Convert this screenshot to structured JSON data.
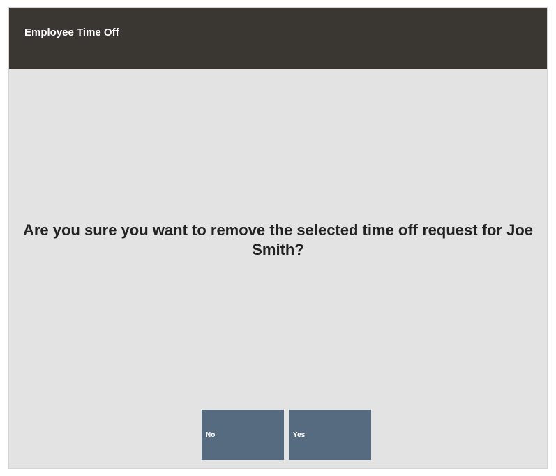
{
  "window": {
    "title": "Employee Time Off"
  },
  "dialog": {
    "message": "Are you sure you want to remove the selected time off request for Joe Smith?"
  },
  "buttons": {
    "no_label": "No",
    "yes_label": "Yes"
  },
  "colors": {
    "titlebar": "#3a3632",
    "background": "#e3e3e3",
    "button": "#566a80"
  }
}
